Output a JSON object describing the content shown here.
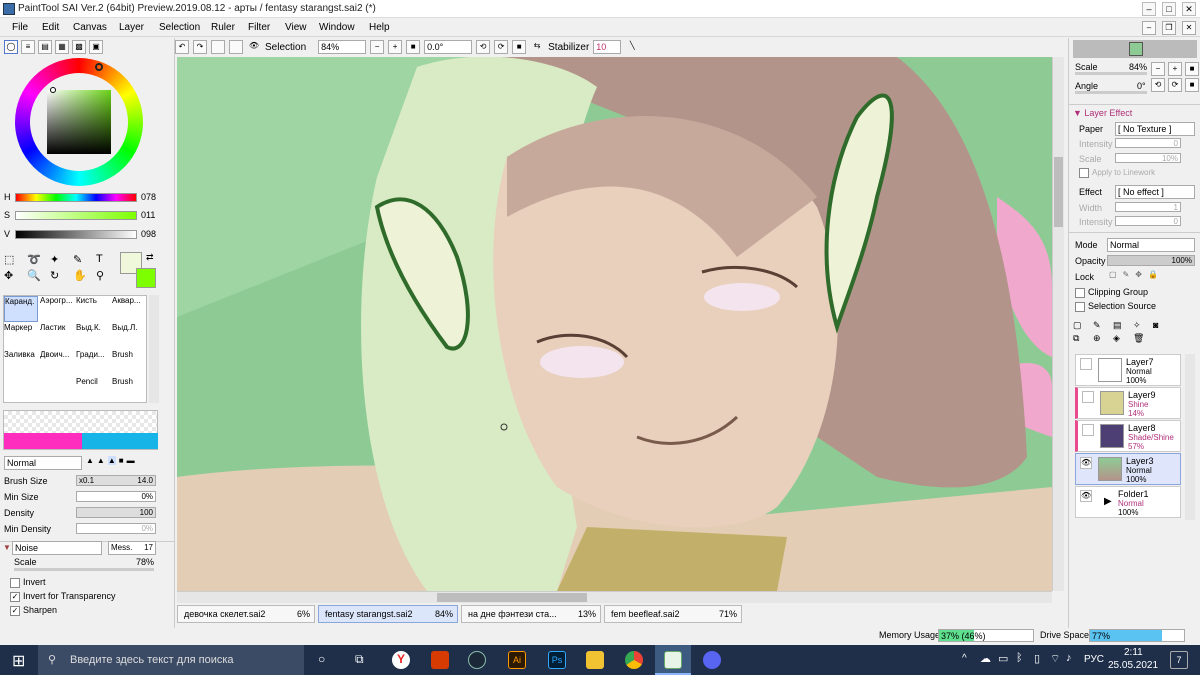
{
  "window": {
    "title": "PaintTool SAI Ver.2 (64bit) Preview.2019.08.12 - арты / fentasy starangst.sai2 (*)"
  },
  "menu": [
    "File",
    "Edit",
    "Canvas",
    "Layer",
    "Selection",
    "Ruler",
    "Filter",
    "View",
    "Window",
    "Help"
  ],
  "toolbar": {
    "selection_label": "Selection",
    "zoom": "84%",
    "angle": "0.0°",
    "stabilizer_label": "Stabilizer",
    "stabilizer_value": "10"
  },
  "color": {
    "h_label": "H",
    "h_value": "078",
    "s_label": "S",
    "s_value": "011",
    "v_label": "V",
    "v_value": "098"
  },
  "tools": [
    "Каранд.",
    "Аэрогр...",
    "Кисть",
    "Аквар...",
    "Маркер",
    "Ластик",
    "Выд.К.",
    "Выд.Л.",
    "Заливка",
    "Двоич...",
    "Гради...",
    "Brush",
    "Pencil",
    "Brush"
  ],
  "brush": {
    "blend_mode": "Normal",
    "size_label": "Brush Size",
    "size_mult": "x0.1",
    "size_value": "14.0",
    "min_size_label": "Min Size",
    "min_size_value": "0%",
    "density_label": "Density",
    "density_value": "100",
    "min_density_label": "Min Density",
    "min_density_value": "0%",
    "texture": "Noise",
    "texture_param_label": "Mess.",
    "texture_param_value": "17",
    "scale_label": "Scale",
    "scale_value": "78%",
    "invert_label": "Invert",
    "invert_checked": false,
    "invert_transparency_label": "Invert for Transparency",
    "invert_transparency_checked": true,
    "sharpen_label": "Sharpen",
    "sharpen_checked": true
  },
  "tabs": [
    {
      "name": "девочка скелет.sai2",
      "pct": "6%"
    },
    {
      "name": "fentasy starangst.sai2",
      "pct": "84%"
    },
    {
      "name": "на дне фэнтези ста...",
      "pct": "13%"
    },
    {
      "name": "fem beefleaf.sai2",
      "pct": "71%"
    }
  ],
  "navigator": {
    "scale_label": "Scale",
    "scale_value": "84%",
    "angle_label": "Angle",
    "angle_value": "0°"
  },
  "layer_effect": {
    "header": "Layer Effect",
    "paper_label": "Paper",
    "paper_value": "[ No Texture ]",
    "intensity_label": "Intensity",
    "intensity_value": "0",
    "scale_label": "Scale",
    "scale_value": "10%",
    "apply_linework": "Apply to Linework",
    "effect_label": "Effect",
    "effect_value": "[ No effect ]",
    "width_label": "Width",
    "width_value": "1",
    "intensity2_label": "Intensity",
    "intensity2_value": "0"
  },
  "layer_props": {
    "mode_label": "Mode",
    "mode_value": "Normal",
    "opacity_label": "Opacity",
    "opacity_value": "100%",
    "lock_label": "Lock",
    "clipping": "Clipping Group",
    "selection_source": "Selection Source"
  },
  "layers": [
    {
      "name": "Layer7",
      "mode": "Normal",
      "opacity": "100%",
      "color": "#ffffff",
      "mode_color": "#000000"
    },
    {
      "name": "Layer9",
      "mode": "Shine",
      "opacity": "14%",
      "color": "#d9d393",
      "mode_color": "#b0307a"
    },
    {
      "name": "Layer8",
      "mode": "Shade/Shine",
      "opacity": "57%",
      "color": "#4d3f73",
      "mode_color": "#b0307a"
    },
    {
      "name": "Layer3",
      "mode": "Normal",
      "opacity": "100%",
      "color": "#a89e8a",
      "mode_color": "#000000"
    },
    {
      "name": "Folder1",
      "mode": "Normal",
      "opacity": "100%",
      "color": "#ffffff",
      "mode_color": "#b0307a"
    }
  ],
  "status": {
    "memory_label": "Memory Usage",
    "memory_value": "37% (46%)",
    "memory_level": 0.37,
    "drive_label": "Drive Space",
    "drive_value": "77%",
    "drive_level": 0.77
  },
  "taskbar": {
    "search_placeholder": "Введите здесь текст для поиска",
    "lang": "РУС",
    "time": "2:11",
    "date": "25.05.2021",
    "notifications": "7"
  }
}
